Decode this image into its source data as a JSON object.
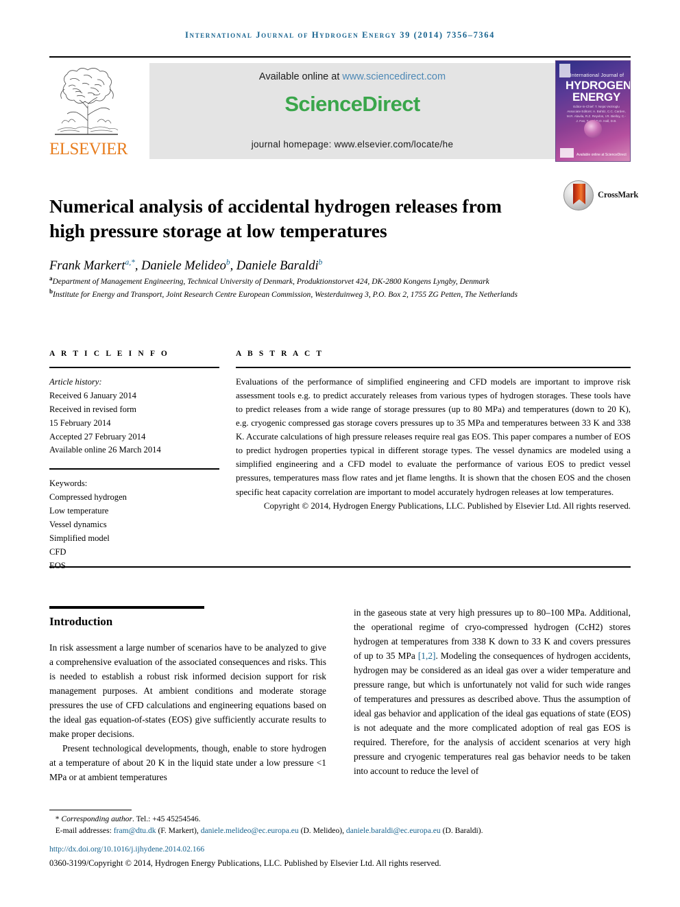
{
  "running_head": "International Journal of Hydrogen Energy 39 (2014) 7356–7364",
  "masthead": {
    "publisher_word": "ELSEVIER",
    "available_prefix": "Available online at ",
    "available_url": "www.sciencedirect.com",
    "sciencedirect_part1": "Science",
    "sciencedirect_part2": "Direct",
    "homepage": "journal homepage: www.elsevier.com/locate/he",
    "cover": {
      "line_small": "International Journal of",
      "line1": "HYDROGEN",
      "line2": "ENERGY",
      "editors": "Editor-in-Chief: T. Nejat Veziroglu\nAssociate Editors: A. Bahtiz, C.C. Carden, M.R. Alavila, R.Z. Reyvlos, I.R. Bielloy,\nC.-J. Fan, T. and D.O. Hall, D.B.",
      "sd_label": "Available online at\nScienceDirect"
    }
  },
  "article": {
    "title": "Numerical analysis of accidental hydrogen releases from high pressure storage at low temperatures",
    "crossmark_label": "CrossMark",
    "authors": [
      {
        "name": "Frank Markert",
        "marks": "a,*"
      },
      {
        "name": "Daniele Melideo",
        "marks": "b"
      },
      {
        "name": "Daniele Baraldi",
        "marks": "b"
      }
    ],
    "affiliations": [
      {
        "mark": "a",
        "text": "Department of Management Engineering, Technical University of Denmark, Produktionstorvet 424, DK-2800 Kongens Lyngby, Denmark"
      },
      {
        "mark": "b",
        "text": "Institute for Energy and Transport, Joint Research Centre European Commission, Westerduinweg 3, P.O. Box 2, 1755 ZG Petten, The Netherlands"
      }
    ]
  },
  "article_info": {
    "heading": "A R T I C L E   I N F O",
    "history_label": "Article history:",
    "history": [
      "Received 6 January 2014",
      "Received in revised form",
      "15 February 2014",
      "Accepted 27 February 2014",
      "Available online 26 March 2014"
    ],
    "keywords_label": "Keywords:",
    "keywords": [
      "Compressed hydrogen",
      "Low temperature",
      "Vessel dynamics",
      "Simplified model",
      "CFD",
      "EOS"
    ]
  },
  "abstract": {
    "heading": "A B S T R A C T",
    "text": "Evaluations of the performance of simplified engineering and CFD models are important to improve risk assessment tools e.g. to predict accurately releases from various types of hydrogen storages. These tools have to predict releases from a wide range of storage pressures (up to 80 MPa) and temperatures (down to 20 K), e.g. cryogenic compressed gas storage covers pressures up to 35 MPa and temperatures between 33 K and 338 K. Accurate calculations of high pressure releases require real gas EOS. This paper compares a number of EOS to predict hydrogen properties typical in different storage types. The vessel dynamics are modeled using a simplified engineering and a CFD model to evaluate the performance of various EOS to predict vessel pressures, temperatures mass flow rates and jet flame lengths. It is shown that the chosen EOS and the chosen specific heat capacity correlation are important to model accurately hydrogen releases at low temperatures.",
    "copyright": "Copyright © 2014, Hydrogen Energy Publications, LLC. Published by Elsevier Ltd. All rights reserved."
  },
  "body": {
    "section_title": "Introduction",
    "left_paragraphs": [
      "In risk assessment a large number of scenarios have to be analyzed to give a comprehensive evaluation of the associated consequences and risks. This is needed to establish a robust risk informed decision support for risk management purposes. At ambient conditions and moderate storage pressures the use of CFD calculations and engineering equations based on the ideal gas equation-of-states (EOS) give sufficiently accurate results to make proper decisions.",
      "Present technological developments, though, enable to store hydrogen at a temperature of about 20 K in the liquid state under a low pressure <1 MPa or at ambient temperatures"
    ],
    "right_paragraph_pre": "in the gaseous state at very high pressures up to 80–100 MPa. Additional, the operational regime of cryo-compressed hydrogen (CcH2) stores hydrogen at temperatures from 338 K down to 33 K and covers pressures of up to 35 MPa ",
    "right_citation": "[1,2]",
    "right_paragraph_post": ". Modeling the consequences of hydrogen accidents, hydrogen may be considered as an ideal gas over a wider temperature and pressure range, but which is unfortunately not valid for such wide ranges of temperatures and pressures as described above. Thus the assumption of ideal gas behavior and application of the ideal gas equations of state (EOS) is not adequate and the more complicated adoption of real gas EOS is required. Therefore, for the analysis of accident scenarios at very high pressure and cryogenic temperatures real gas behavior needs to be taken into account to reduce the level of"
  },
  "footer": {
    "corresponding_prefix": "Corresponding author",
    "corresponding_tel": ". Tel.: +45 45254546.",
    "email_label": "E-mail addresses:",
    "emails": [
      {
        "address": "fram@dtu.dk",
        "who": "(F. Markert)"
      },
      {
        "address": "daniele.melideo@ec.europa.eu",
        "who": "(D. Melideo)"
      },
      {
        "address": "daniele.baraldi@ec.europa.eu",
        "who": "(D. Baraldi)."
      }
    ],
    "doi": "http://dx.doi.org/10.1016/j.ijhydene.2014.02.166",
    "issn_copyright": "0360-3199/Copyright © 2014, Hydrogen Energy Publications, LLC. Published by Elsevier Ltd. All rights reserved."
  },
  "colors": {
    "link": "#17638f",
    "sciencedirect_green": "#3aa64b",
    "elsevier_orange": "#e87d1e"
  }
}
